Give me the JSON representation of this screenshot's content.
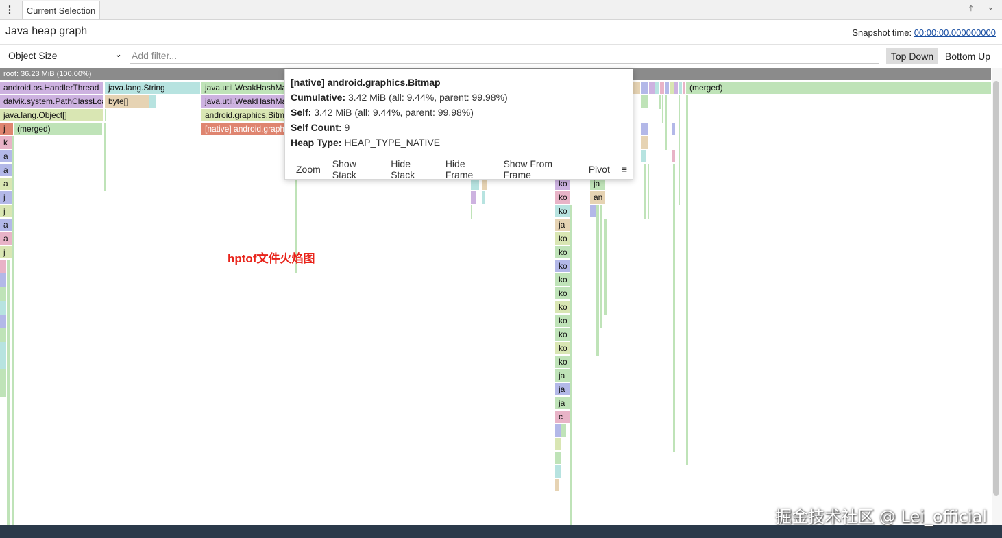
{
  "tabbar": {
    "menu_icon": "⋮",
    "tab_label": "Current Selection",
    "pin_icon": "⤒",
    "collapse_icon": "⌄"
  },
  "header": {
    "title": "Java heap graph",
    "snapshot_label": "Snapshot time: ",
    "snapshot_value": "00:00:00.000000000"
  },
  "toolbar": {
    "metric": "Object Size",
    "filter_placeholder": "Add filter...",
    "top_down": "Top Down",
    "bottom_up": "Bottom Up"
  },
  "flame": {
    "root": "root: 36.23 MiB (100.00%)",
    "labels": {
      "handler_thread": "android.os.HandlerThread",
      "java_string": "java.lang.String",
      "weak1": "java.util.WeakHashMap$",
      "merged_top": "(merged)",
      "path_class_loader": "dalvik.system.PathClassLoa",
      "byte_arr": "byte[]",
      "weak2": "java.util.WeakHashMap$",
      "object_arr": "java.lang.Object[]",
      "bitmap": "android.graphics.Bitma",
      "j": "j",
      "merged_left": "(merged)",
      "native_bitmap": "[native] android.graph",
      "col_left": [
        "k",
        "a",
        "a",
        "a",
        "j",
        "j",
        "a",
        "a",
        "j"
      ],
      "col_ko": [
        "ko",
        "ko",
        "ko",
        "ja",
        "ko",
        "ko",
        "ko",
        "ko",
        "ko",
        "ko",
        "ko",
        "ko",
        "ko",
        "ko",
        "ja",
        "ja",
        "ja",
        "c"
      ],
      "ja_right": "ja",
      "an_right": "an"
    }
  },
  "tooltip": {
    "title": "[native] android.graphics.Bitmap",
    "cumulative_label": "Cumulative:",
    "cumulative_value": " 3.42 MiB (all: 9.44%, parent: 99.98%)",
    "self_label": "Self:",
    "self_value": " 3.42 MiB (all: 9.44%, parent: 99.98%)",
    "self_count_label": "Self Count:",
    "self_count_value": " 9",
    "heap_type_label": "Heap Type:",
    "heap_type_value": " HEAP_TYPE_NATIVE",
    "actions": {
      "zoom": "Zoom",
      "show_stack": "Show Stack",
      "hide_stack": "Hide Stack",
      "hide_frame": "Hide Frame",
      "show_from_frame": "Show From Frame",
      "pivot": "Pivot"
    },
    "menu_icon": "≡"
  },
  "annotation": "hptof文件火焰图",
  "watermark": "掘金技术社区 @ Lei_official",
  "colors": {
    "root": "#8b8b8b",
    "green": "#bfe3b8",
    "purple": "#cdb2e0",
    "teal": "#b7e3e0",
    "tan": "#e6d3b3",
    "red": "#df8570",
    "blue": "#b3b8e8",
    "pink": "#e8b3c7",
    "yellowgreen": "#d9e6b3",
    "annotation": "#e8231a"
  }
}
